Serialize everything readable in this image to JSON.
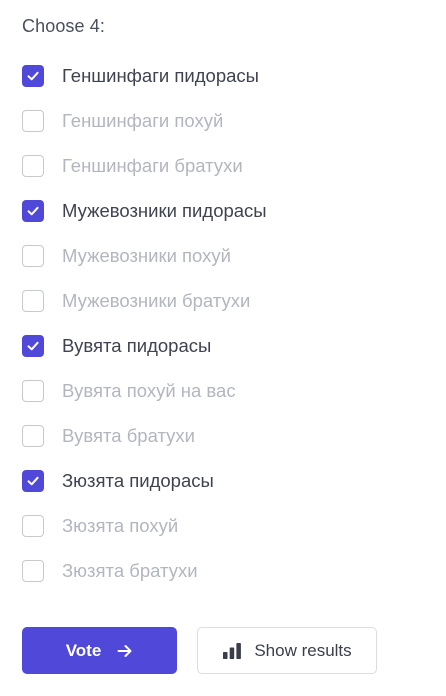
{
  "poll": {
    "prompt": "Choose 4:",
    "options": [
      {
        "label": "Геншинфаги пидорасы",
        "checked": true
      },
      {
        "label": "Геншинфаги похуй",
        "checked": false
      },
      {
        "label": "Геншинфаги братухи",
        "checked": false
      },
      {
        "label": "Мужевозники пидорасы",
        "checked": true
      },
      {
        "label": "Мужевозники похуй",
        "checked": false
      },
      {
        "label": "Мужевозники братухи",
        "checked": false
      },
      {
        "label": "Вувята пидорасы",
        "checked": true
      },
      {
        "label": "Вувята похуй на вас",
        "checked": false
      },
      {
        "label": "Вувята братухи",
        "checked": false
      },
      {
        "label": "Зюзята пидорасы",
        "checked": true
      },
      {
        "label": "Зюзята похуй",
        "checked": false
      },
      {
        "label": "Зюзята братухи",
        "checked": false
      }
    ]
  },
  "actions": {
    "vote_label": "Vote",
    "show_results_label": "Show results",
    "vote_icon": "arrow-right-icon",
    "results_icon": "bar-chart-icon"
  },
  "colors": {
    "accent": "#5048d8",
    "text_checked": "#3f4350",
    "text_unchecked": "#b3b6bf",
    "checkbox_border": "#c7c9d1"
  }
}
